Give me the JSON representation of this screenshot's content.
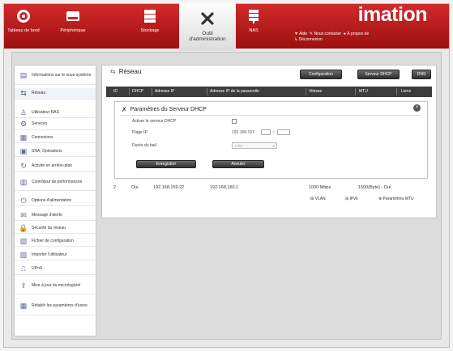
{
  "header": {
    "brand": "imation",
    "nav": [
      {
        "label": "Tableau de bord",
        "icon": "dashboard-gauge-icon"
      },
      {
        "label": "Périphérique",
        "icon": "device-drive-icon"
      },
      {
        "label": "Stockage",
        "icon": "storage-disks-icon"
      },
      {
        "label": "Outil\nd'administration",
        "icon": "admin-tools-icon",
        "active": true
      },
      {
        "label": "NAS",
        "icon": "nas-server-icon"
      }
    ],
    "toplinks": [
      "Aide",
      "Nous contacter",
      "À propos de",
      "Déconnexion"
    ]
  },
  "sidebar": {
    "items": [
      {
        "label": "Informations sur le sous-système",
        "icon": "info-icon"
      },
      {
        "label": "Réseau",
        "icon": "network-icon",
        "active": true
      },
      {
        "label": "Utilisateur NAS",
        "icon": "user-icon"
      },
      {
        "label": "Services",
        "icon": "services-icon"
      },
      {
        "label": "Connexions",
        "icon": "connections-icon"
      },
      {
        "label": "SNA, Opérations",
        "icon": "operations-icon"
      },
      {
        "label": "Activité en arrière-plan",
        "icon": "background-activity-icon"
      },
      {
        "label": "Contrôleur de performances",
        "icon": "performance-icon"
      },
      {
        "label": "Options d'alimentation",
        "icon": "power-icon"
      },
      {
        "label": "Message d'alerte",
        "icon": "alert-message-icon"
      },
      {
        "label": "Sécurité du réseau",
        "icon": "lock-icon"
      },
      {
        "label": "Fichier de configuration",
        "icon": "config-file-icon"
      },
      {
        "label": "Importer l'utilisateur",
        "icon": "import-user-icon"
      },
      {
        "label": "UPnS",
        "icon": "upnp-icon"
      },
      {
        "label": "Mise à jour du micrologiciel",
        "icon": "firmware-update-icon"
      },
      {
        "label": "Rétablir les paramètres d'usine",
        "icon": "factory-reset-icon"
      }
    ]
  },
  "main": {
    "title": "Réseau",
    "buttons": [
      "Configuration",
      "Serveur DHCP",
      "DNS"
    ],
    "columns": [
      "ID",
      "DHCP",
      "Adresse IP",
      "Adresse IP de la passerelle",
      "Vitesse",
      "MTU",
      "Liens"
    ],
    "dialog": {
      "title": "Paramètres du Serveur DHCP",
      "fields": [
        {
          "label": "Activer le serveur DHCP"
        },
        {
          "label": "Plage IP",
          "value": "192.168.157."
        },
        {
          "label": "Durée du bail",
          "value": "Infini"
        }
      ],
      "buttons": [
        "Enregistrer",
        "Annuler"
      ]
    },
    "row": {
      "id": "2",
      "dhcp": "Oui",
      "ip": "192.168.159.22",
      "gateway": "192.168.160.1",
      "speed": "1000 Mbps",
      "mtu": "1500(Byte) - Oui",
      "links": [
        "VLAN",
        "IPv6",
        "Paramètres MTU"
      ]
    }
  },
  "colors": {
    "brand_red": "#b81b1b",
    "dark_header": "#3c3c3c"
  }
}
